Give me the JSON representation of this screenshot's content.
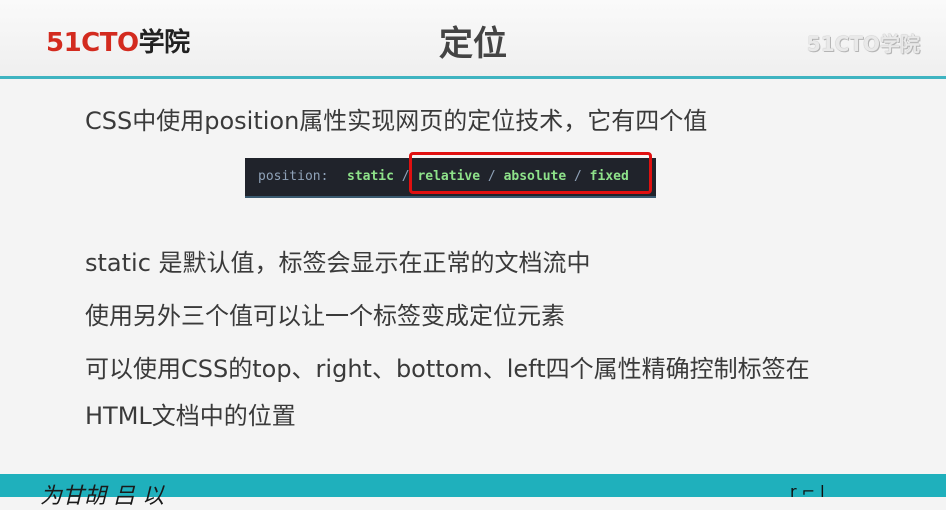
{
  "header": {
    "logo_left": {
      "brand": "51CTO",
      "suffix": "学院"
    },
    "title": "定位",
    "logo_right": "51CTO学院"
  },
  "content": {
    "intro": "CSS中使用position属性实现网页的定位技术，它有四个值",
    "code": {
      "property": "position:",
      "values": [
        "static",
        "relative",
        "absolute",
        "fixed"
      ],
      "separator": "/"
    },
    "lines": [
      "static 是默认值，标签会显示在正常的文档流中",
      "使用另外三个值可以让一个标签变成定位元素",
      "可以使用CSS的top、right、bottom、left四个属性精确控制标签在",
      "HTML文档中的位置"
    ]
  },
  "footer": {
    "handwriting": "为甘胡 吕 以"
  },
  "colors": {
    "accent_teal": "#1fb0bc",
    "logo_red": "#d32b1f",
    "highlight_red": "#e01010",
    "code_bg": "#20232b",
    "code_value": "#8ee28a"
  }
}
